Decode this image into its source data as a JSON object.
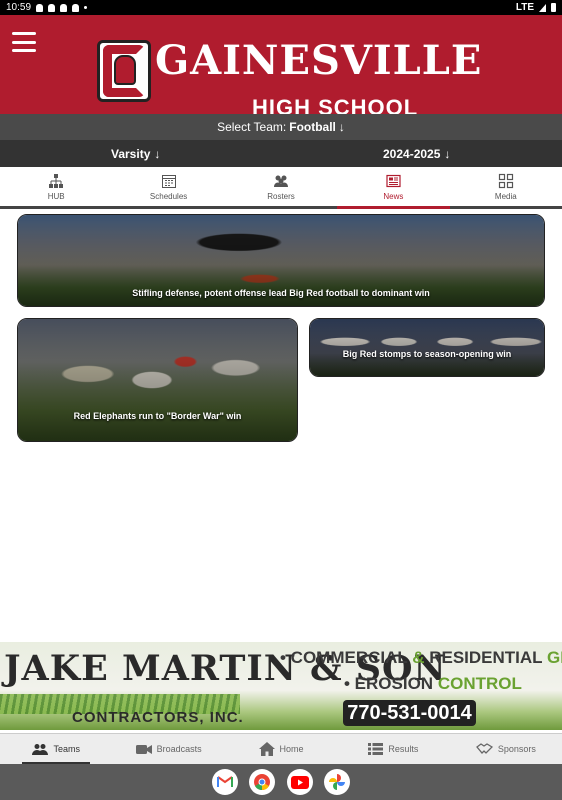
{
  "status_bar": {
    "time": "10:59",
    "network": "LTE"
  },
  "header": {
    "school_name": "GAINESVILLE",
    "school_sub": "HIGH SCHOOL"
  },
  "team_selector": {
    "label": "Select Team:",
    "value": "Football",
    "arrow": "↓"
  },
  "filters": [
    {
      "label": "Varsity",
      "arrow": "↓"
    },
    {
      "label": "2024-2025",
      "arrow": "↓"
    }
  ],
  "tabs": [
    {
      "label": "HUB",
      "icon": "hierarchy-icon"
    },
    {
      "label": "Schedules",
      "icon": "calendar-icon"
    },
    {
      "label": "Rosters",
      "icon": "people-icon"
    },
    {
      "label": "News",
      "icon": "newspaper-icon",
      "active": true
    },
    {
      "label": "Media",
      "icon": "grid-icon"
    }
  ],
  "news": [
    {
      "caption": "Stifling defense, potent offense lead Big Red football to dominant win"
    },
    {
      "caption": "Red Elephants run to \"Border War\" win"
    },
    {
      "caption": "Big Red stomps to season-opening win"
    }
  ],
  "ad": {
    "name": "JAKE MARTIN & SON",
    "sub": "CONTRACTORS, INC.",
    "line1_a": "• COMMERCIAL ",
    "line1_amp": "& ",
    "line1_b": "RESIDENTIAL ",
    "line1_c": "GRASSING",
    "line2_a": "• EROSION ",
    "line2_b": "CONTROL",
    "phone": "770-531-0014"
  },
  "bottom_nav": [
    {
      "label": "Teams",
      "icon": "people-icon",
      "active": true
    },
    {
      "label": "Broadcasts",
      "icon": "video-camera-icon"
    },
    {
      "label": "Home",
      "icon": "home-icon"
    },
    {
      "label": "Results",
      "icon": "list-icon"
    },
    {
      "label": "Sponsors",
      "icon": "handshake-icon"
    }
  ],
  "dock": [
    "gmail-icon",
    "chrome-icon",
    "youtube-icon",
    "photos-icon"
  ],
  "colors": {
    "brand_red": "#b01c2e",
    "dark_bar": "#333333",
    "team_bar": "#4a4a4a"
  }
}
